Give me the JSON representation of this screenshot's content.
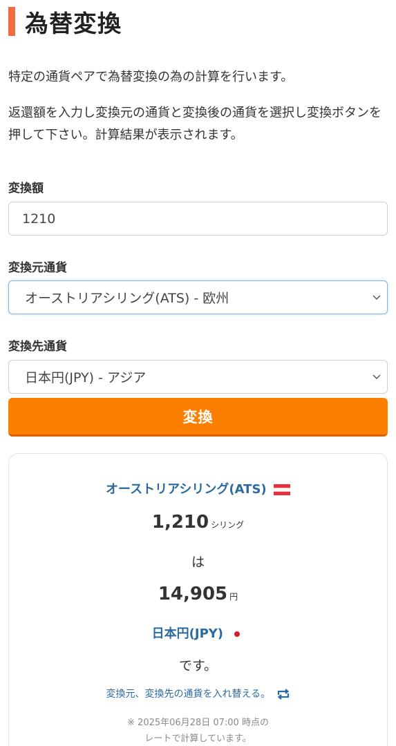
{
  "header": {
    "title": "為替変換"
  },
  "description": {
    "line1": "特定の通貨ペアで為替変換の為の計算を行います。",
    "line2": "返還額を入力し変換元の通貨と変換後の通貨を選択し変換ボタンを押して下さい。計算結果が表示されます。"
  },
  "form": {
    "amount_label": "変換額",
    "amount_value": "1210",
    "from_label": "変換元通貨",
    "from_selected": "オーストリアシリング(ATS) - 欧州",
    "to_label": "変換先通貨",
    "to_selected": "日本円(JPY) - アジア",
    "convert_label": "変換"
  },
  "result": {
    "from_currency": "オーストリアシリング(ATS)",
    "from_amount": "1,210",
    "from_unit": "シリング",
    "connector": "は",
    "to_amount": "14,905",
    "to_unit": "円",
    "to_currency": "日本円(JPY)",
    "suffix": "です。",
    "swap_link": "変換元、変換先の通貨を入れ替える。",
    "note_line1": "※ 2025年06月28日 07:00 時点の",
    "note_line2": "レートで計算しています。"
  },
  "colors": {
    "accent": "#f26d3d",
    "button": "#fc7f01",
    "link": "#2b6aa0"
  },
  "icons": {
    "austria_flag": "austria-flag-icon",
    "japan_flag": "japan-flag-icon",
    "swap": "swap-icon",
    "chevron": "chevron-down-icon"
  }
}
